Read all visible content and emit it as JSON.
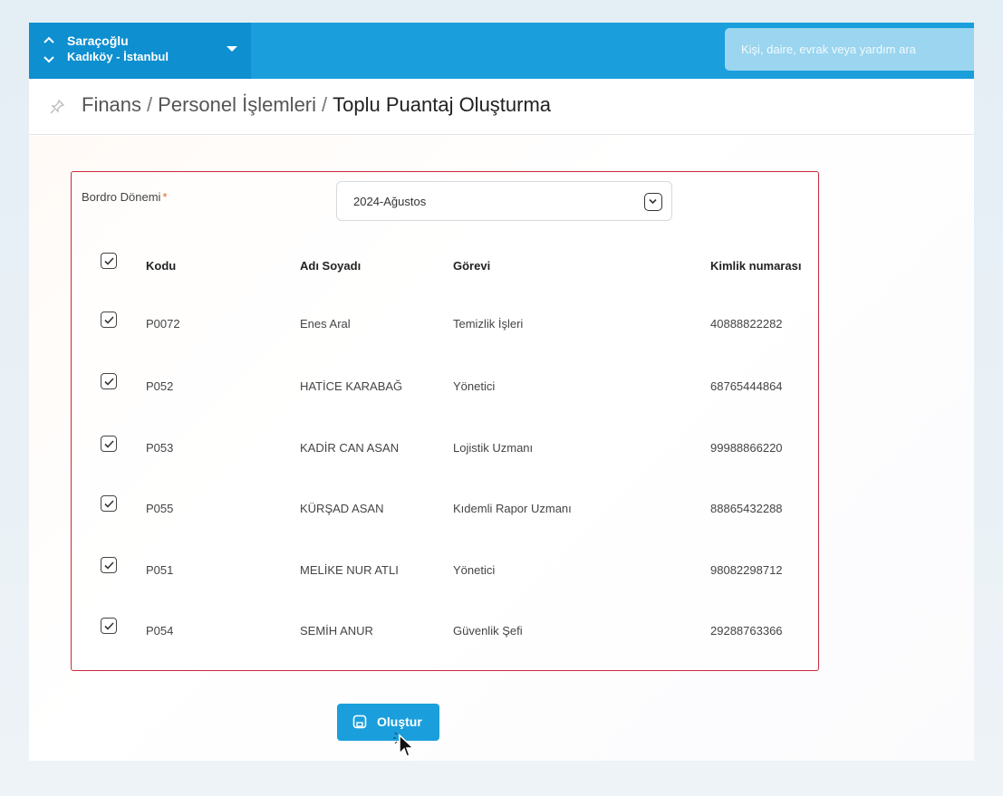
{
  "header": {
    "org_name": "Saraçoğlu",
    "org_location": "Kadıköy - İstanbul",
    "search_placeholder": "Kişi, daire, evrak veya yardım ara"
  },
  "breadcrumb": {
    "items": [
      "Finans",
      "Personel İşlemleri"
    ],
    "current": "Toplu Puantaj Oluşturma",
    "separator": "/"
  },
  "form": {
    "period_label": "Bordro Dönemi",
    "required_mark": "*",
    "period_value": "2024-Ağustos"
  },
  "table": {
    "columns": [
      "Kodu",
      "Adı Soyadı",
      "Görevi",
      "Kimlik numarası"
    ],
    "header_checked": true,
    "rows": [
      {
        "checked": true,
        "code": "P0072",
        "name": "Enes Aral",
        "role": "Temizlik İşleri",
        "id": "40888822282"
      },
      {
        "checked": true,
        "code": "P052",
        "name": "HATİCE KARABAĞ",
        "role": "Yönetici",
        "id": "68765444864"
      },
      {
        "checked": true,
        "code": "P053",
        "name": "KADİR CAN ASAN",
        "role": "Lojistik Uzmanı",
        "id": "99988866220"
      },
      {
        "checked": true,
        "code": "P055",
        "name": "KÜRŞAD ASAN",
        "role": "Kıdemli Rapor Uzmanı",
        "id": "88865432288"
      },
      {
        "checked": true,
        "code": "P051",
        "name": "MELİKE NUR ATLI",
        "role": "Yönetici",
        "id": "98082298712"
      },
      {
        "checked": true,
        "code": "P054",
        "name": "SEMİH ANUR",
        "role": "Güvenlik Şefi",
        "id": "29288763366"
      }
    ]
  },
  "actions": {
    "create_label": "Oluştur"
  },
  "colors": {
    "accent": "#1a9fdc",
    "accent_dark": "#0d8fd0",
    "panel_border": "#c92a3a",
    "required": "#e06a2a"
  },
  "icons": {
    "org_toggle": "chevron-up-down-icon",
    "org_dropdown": "caret-down-icon",
    "pin": "pin-icon",
    "select": "chevron-down-icon",
    "checkbox": "check-icon",
    "create": "save-icon"
  }
}
